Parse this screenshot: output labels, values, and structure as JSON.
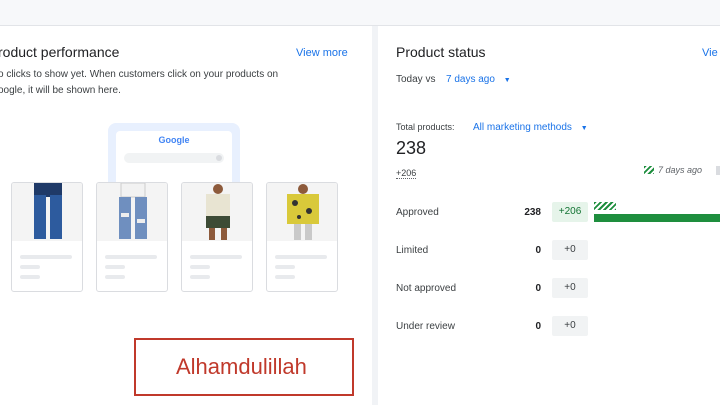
{
  "performance": {
    "title": "roduct performance",
    "view_more": "View more",
    "desc_line1": "o clicks to show yet. When customers click on your products on",
    "desc_line2": "oogle, it will be shown here.",
    "google_logo": "Google"
  },
  "stamp": "Alhamdulillah",
  "status": {
    "title": "Product status",
    "view": "Vie",
    "compare_prefix": "Today vs",
    "compare_link": "7 days ago",
    "total_label": "Total products:",
    "total_filter": "All marketing methods",
    "total_value": "238",
    "total_delta": "+206",
    "legend_7days": "7 days ago",
    "rows": [
      {
        "label": "Approved",
        "count": "238",
        "delta": "+206"
      },
      {
        "label": "Limited",
        "count": "0",
        "delta": "+0"
      },
      {
        "label": "Not approved",
        "count": "0",
        "delta": "+0"
      },
      {
        "label": "Under review",
        "count": "0",
        "delta": "+0"
      }
    ],
    "approved_fraction": 1.0
  },
  "colors": {
    "accent": "#1a73e8",
    "positive": "#1e8e3e",
    "stamp": "#c0392b"
  }
}
